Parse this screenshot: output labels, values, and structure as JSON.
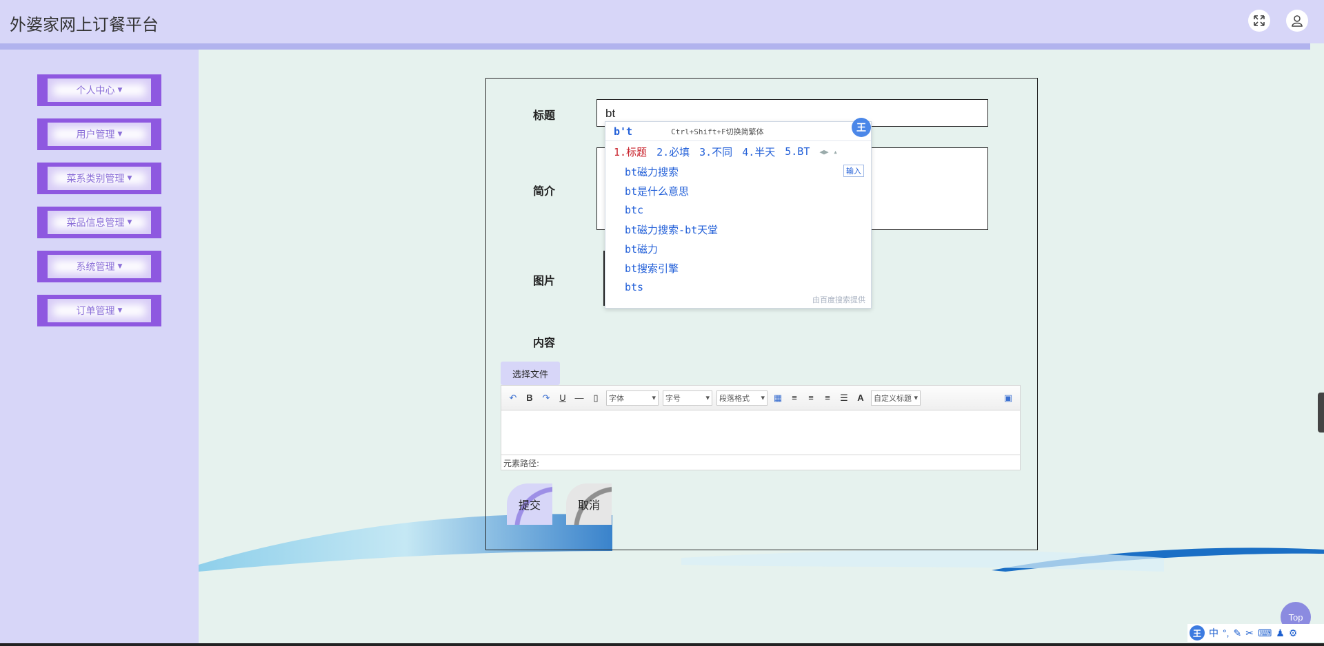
{
  "app": {
    "title": "外婆家网上订餐平台"
  },
  "header": {
    "fullscreen_icon": "expand-icon",
    "user_icon": "user-icon"
  },
  "sidebar": {
    "items": [
      {
        "label": "个人中心"
      },
      {
        "label": "用户管理"
      },
      {
        "label": "菜系类别管理"
      },
      {
        "label": "菜品信息管理"
      },
      {
        "label": "系统管理"
      },
      {
        "label": "订单管理"
      }
    ]
  },
  "form": {
    "title_label": "标题",
    "title_value": "bt",
    "intro_label": "简介",
    "image_label": "图片",
    "content_label": "内容",
    "file_button": "选择文件",
    "submit_label": "提交",
    "cancel_label": "取消"
  },
  "editor": {
    "font_select": "字体",
    "size_select": "字号",
    "paragraph_select": "段落格式",
    "custom_title_select": "自定义标题",
    "bold": "B",
    "underline": "U",
    "font_color": "A",
    "path_label": "元素路径:"
  },
  "ime": {
    "composition": "b't",
    "hint": "Ctrl+Shift+F切换简繁体",
    "badge": "王",
    "candidates": [
      "1.标题",
      "2.必填",
      "3.不同",
      "4.半天",
      "5.BT"
    ],
    "input_tag": "输入",
    "suggestions": [
      "bt磁力搜索",
      "bt是什么意思",
      "btc",
      "bt磁力搜索-bt天堂",
      "bt磁力",
      "bt搜索引擎",
      "bts"
    ],
    "footer": "由百度搜索提供"
  },
  "top_button": {
    "label": "Top"
  },
  "ime_bar": {
    "logo": "王",
    "mode": "中"
  },
  "colors": {
    "header_bg": "#d7d6f8",
    "accent_purple": "#8e58e0",
    "page_bg": "#e6f2ee"
  }
}
